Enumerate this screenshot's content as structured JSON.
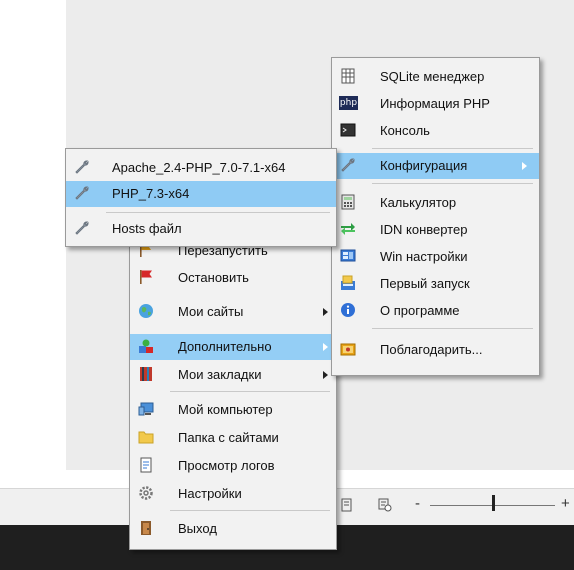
{
  "tray_menu": {
    "items": [
      {
        "label": "Перезапустить",
        "icon": "restart-flag-icon"
      },
      {
        "label": "Остановить",
        "icon": "red-flag-icon"
      },
      {
        "label": "Мои сайты",
        "icon": "globe-icon"
      },
      {
        "label": "Дополнительно",
        "icon": "shapes-icon"
      },
      {
        "label": "Мои закладки",
        "icon": "bookmarks-icon"
      },
      {
        "label": "Мой компьютер",
        "icon": "computer-icon"
      },
      {
        "label": "Папка с сайтами",
        "icon": "folder-icon"
      },
      {
        "label": "Просмотр логов",
        "icon": "log-icon"
      },
      {
        "label": "Настройки",
        "icon": "gear-icon"
      },
      {
        "label": "Выход",
        "icon": "exit-door-icon"
      }
    ]
  },
  "additional_menu": {
    "items": [
      {
        "label": "SQLite менеджер",
        "icon": "database-icon"
      },
      {
        "label": "Информация PHP",
        "icon": "php-icon",
        "icon_text": "php"
      },
      {
        "label": "Консоль",
        "icon": "console-icon"
      },
      {
        "label": "Конфигурация",
        "icon": "wrench-icon"
      },
      {
        "label": "Калькулятор",
        "icon": "calculator-icon"
      },
      {
        "label": "IDN конвертер",
        "icon": "idn-icon"
      },
      {
        "label": "Win настройки",
        "icon": "win-settings-icon"
      },
      {
        "label": "Первый запуск",
        "icon": "first-run-icon"
      },
      {
        "label": "О программе",
        "icon": "info-icon"
      },
      {
        "label": "Поблагодарить...",
        "icon": "thanks-icon"
      }
    ]
  },
  "config_menu": {
    "items": [
      {
        "label": "Apache_2.4-PHP_7.0-7.1-x64",
        "icon": "wrench-icon"
      },
      {
        "label": "PHP_7.3-x64",
        "icon": "wrench-icon"
      },
      {
        "label": "Hosts файл",
        "icon": "wrench-icon"
      }
    ]
  },
  "statusbar": {
    "zoom_minus": "-",
    "zoom_plus": "+"
  },
  "colors": {
    "highlight": "#8fcbf4",
    "menu_bg": "#f2f2f2",
    "taskbar": "#1f1f1f"
  }
}
